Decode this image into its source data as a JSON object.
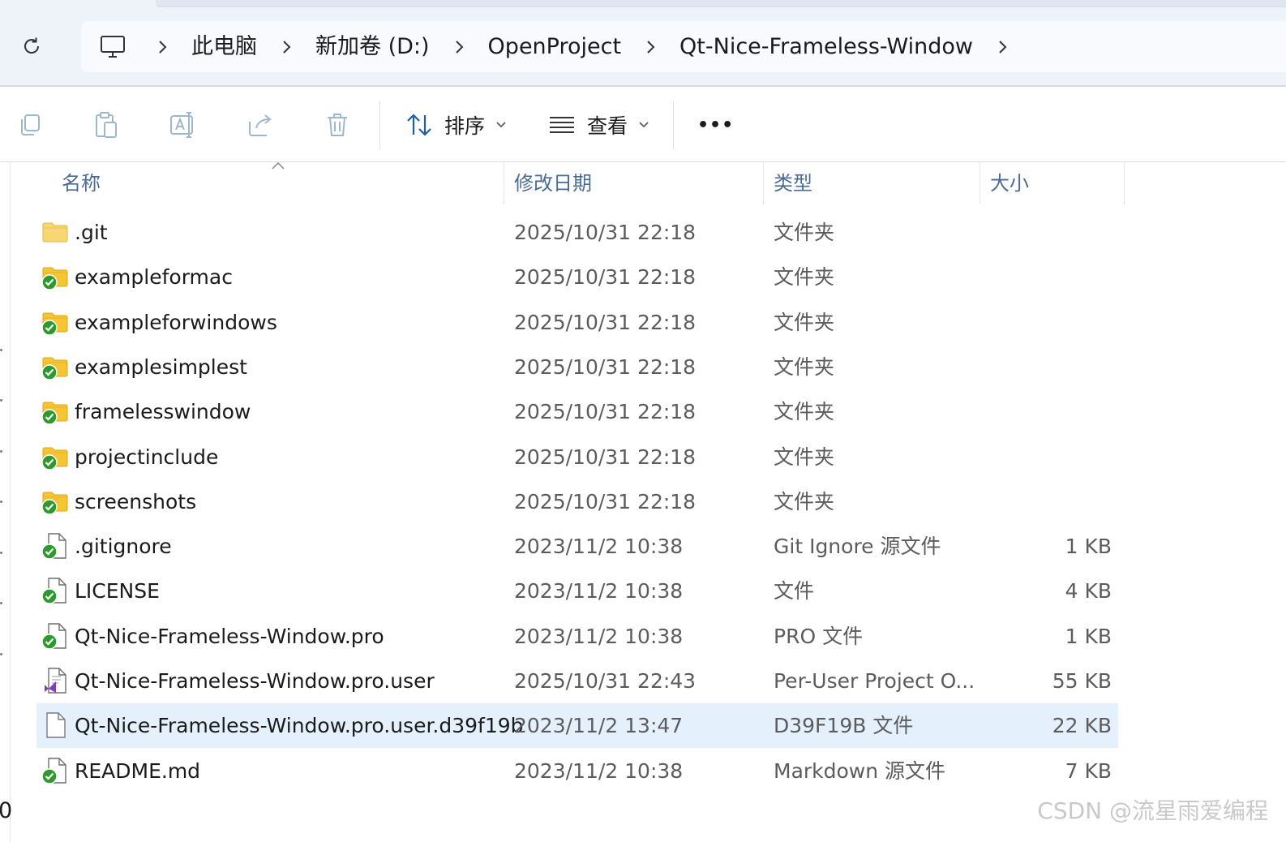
{
  "breadcrumb": {
    "items": [
      "此电脑",
      "新加卷 (D:)",
      "OpenProject",
      "Qt-Nice-Frameless-Window"
    ]
  },
  "toolbar": {
    "sort_label": "排序",
    "view_label": "查看",
    "more_label": "•••"
  },
  "columns": {
    "name": "名称",
    "modified": "修改日期",
    "type": "类型",
    "size": "大小"
  },
  "files": [
    {
      "name": ".git",
      "date": "2025/10/31 22:18",
      "type": "文件夹",
      "size": "",
      "icon": "folder-icon"
    },
    {
      "name": "exampleformac",
      "date": "2025/10/31 22:18",
      "type": "文件夹",
      "size": "",
      "icon": "folder-synced-icon"
    },
    {
      "name": "exampleforwindows",
      "date": "2025/10/31 22:18",
      "type": "文件夹",
      "size": "",
      "icon": "folder-synced-icon"
    },
    {
      "name": "examplesimplest",
      "date": "2025/10/31 22:18",
      "type": "文件夹",
      "size": "",
      "icon": "folder-synced-icon"
    },
    {
      "name": "framelesswindow",
      "date": "2025/10/31 22:18",
      "type": "文件夹",
      "size": "",
      "icon": "folder-synced-icon"
    },
    {
      "name": "projectinclude",
      "date": "2025/10/31 22:18",
      "type": "文件夹",
      "size": "",
      "icon": "folder-synced-icon"
    },
    {
      "name": "screenshots",
      "date": "2025/10/31 22:18",
      "type": "文件夹",
      "size": "",
      "icon": "folder-synced-icon"
    },
    {
      "name": ".gitignore",
      "date": "2023/11/2 10:38",
      "type": "Git Ignore 源文件",
      "size": "1 KB",
      "icon": "file-synced-icon"
    },
    {
      "name": "LICENSE",
      "date": "2023/11/2 10:38",
      "type": "文件",
      "size": "4 KB",
      "icon": "file-synced-icon"
    },
    {
      "name": "Qt-Nice-Frameless-Window.pro",
      "date": "2023/11/2 10:38",
      "type": "PRO 文件",
      "size": "1 KB",
      "icon": "file-synced-icon"
    },
    {
      "name": "Qt-Nice-Frameless-Window.pro.user",
      "date": "2025/10/31 22:43",
      "type": "Per-User Project O...",
      "size": "55 KB",
      "icon": "visual-studio-file-icon"
    },
    {
      "name": "Qt-Nice-Frameless-Window.pro.user.d39f19b",
      "date": "2023/11/2 13:47",
      "type": "D39F19B 文件",
      "size": "22 KB",
      "icon": "blank-file-icon",
      "selected": true
    },
    {
      "name": "README.md",
      "date": "2023/11/2 10:38",
      "type": "Markdown 源文件",
      "size": "7 KB",
      "icon": "file-synced-icon"
    }
  ],
  "stray_char": "0",
  "watermark": "CSDN @流星雨爱编程"
}
